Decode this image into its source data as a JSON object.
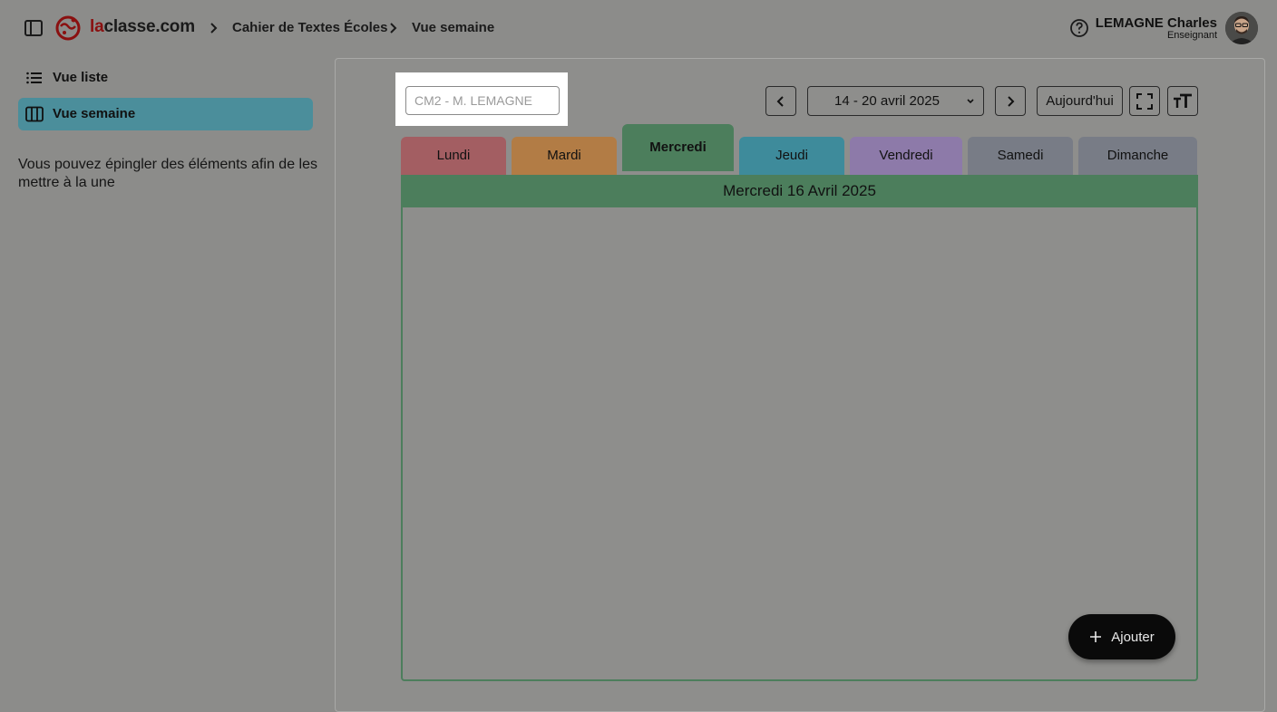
{
  "header": {
    "brand_prefix": "la",
    "brand_rest": "classe.com",
    "breadcrumb": [
      "Cahier de Textes Écoles",
      "Vue semaine"
    ],
    "user_name": "LEMAGNE Charles",
    "user_role": "Enseignant"
  },
  "sidebar": {
    "items": [
      {
        "label": "Vue liste",
        "icon": "list-icon",
        "active": false
      },
      {
        "label": "Vue semaine",
        "icon": "week-columns-icon",
        "active": true
      }
    ],
    "hint": "Vous pouvez épingler des éléments afin de les mettre à la une"
  },
  "toolbar": {
    "class_placeholder": "CM2 - M. LEMAGNE",
    "week_range": "14 - 20 avril 2025",
    "today_label": "Aujourd'hui"
  },
  "tabs": [
    {
      "label": "Lundi",
      "color": "#a35e62"
    },
    {
      "label": "Mardi",
      "color": "#b27c45"
    },
    {
      "label": "Mercredi",
      "color": "#4c7e5c",
      "active": true
    },
    {
      "label": "Jeudi",
      "color": "#3e8b9b"
    },
    {
      "label": "Vendredi",
      "color": "#8d7aa9"
    },
    {
      "label": "Samedi",
      "color": "#787c86"
    },
    {
      "label": "Dimanche",
      "color": "#787c86"
    }
  ],
  "day": {
    "title": "Mercredi 16 Avril 2025"
  },
  "fab": {
    "label": "Ajouter"
  }
}
